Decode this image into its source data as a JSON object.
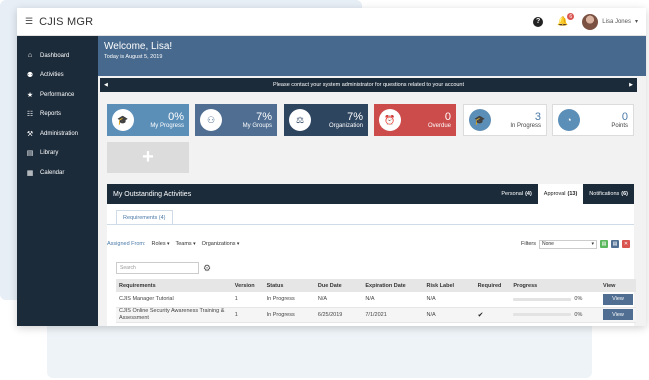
{
  "app": {
    "title": "CJIS MGR"
  },
  "header": {
    "user_name": "Lisa Jones",
    "notification_count": "6"
  },
  "sidebar": {
    "items": [
      {
        "label": "Dashboard",
        "icon": "dashboard-icon",
        "glyph": "⌂"
      },
      {
        "label": "Activities",
        "icon": "users-icon",
        "glyph": "⚉"
      },
      {
        "label": "Performance",
        "icon": "star-icon",
        "glyph": "★"
      },
      {
        "label": "Reports",
        "icon": "reports-icon",
        "glyph": "☷"
      },
      {
        "label": "Administration",
        "icon": "admin-icon",
        "glyph": "⚒"
      },
      {
        "label": "Library",
        "icon": "library-icon",
        "glyph": "▤"
      },
      {
        "label": "Calendar",
        "icon": "calendar-icon",
        "glyph": "▦"
      }
    ]
  },
  "welcome": {
    "title": "Welcome, Lisa!",
    "date": "Today is August 5, 2019"
  },
  "notice": {
    "text": "Please contact your system administrator for questions related to your account"
  },
  "tiles": [
    {
      "value": "0%",
      "label": "My Progress",
      "color": "#5c8fb8",
      "icon": "cap-icon"
    },
    {
      "value": "7%",
      "label": "My Groups",
      "color": "#4f6e92",
      "icon": "group-icon"
    },
    {
      "value": "7%",
      "label": "Organization",
      "color": "#2e4560",
      "icon": "scales-icon"
    },
    {
      "value": "0",
      "label": "Overdue",
      "color": "#cc4b4b",
      "icon": "alarm-icon"
    },
    {
      "value": "3",
      "label": "In Progress",
      "color": "#ffffff",
      "icon": "cap-icon"
    },
    {
      "value": "0",
      "label": "Points",
      "color": "#ffffff",
      "icon": "gauge-icon"
    }
  ],
  "panel": {
    "title": "My Outstanding Activities",
    "tabs": [
      {
        "label": "Personal",
        "count": "(4)"
      },
      {
        "label": "Approval",
        "count": "(13)"
      },
      {
        "label": "Notifications",
        "count": "(6)"
      }
    ],
    "subtab": "Requirements (4)",
    "assigned_from_label": "Assigned From:",
    "dropdowns": [
      "Roles",
      "Teams",
      "Organizations"
    ],
    "filters_label": "Filters",
    "filter_value": "None",
    "search_placeholder": "Search",
    "columns": [
      "Requirements",
      "Version",
      "Status",
      "Due Date",
      "Expiration Date",
      "Risk Label",
      "Required",
      "Progress",
      "View"
    ],
    "rows": [
      {
        "requirement": "CJIS Manager Tutorial",
        "version": "1",
        "status": "In Progress",
        "due": "N/A",
        "expiration": "N/A",
        "risk": "N/A",
        "required": false,
        "progress": "0%",
        "view": "View"
      },
      {
        "requirement": "CJIS Online Security Awareness Training & Assessment",
        "version": "1",
        "status": "In Progress",
        "due": "6/25/2019",
        "expiration": "7/1/2021",
        "risk": "N/A",
        "required": true,
        "progress": "0%",
        "view": "View"
      }
    ]
  }
}
